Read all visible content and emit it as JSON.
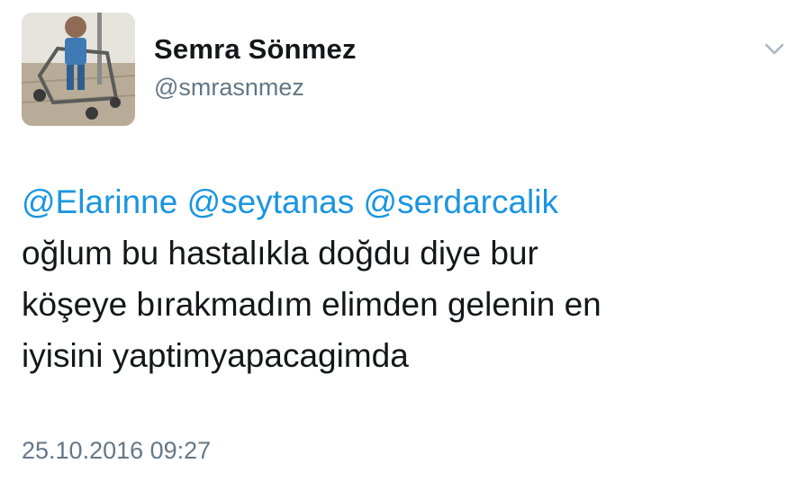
{
  "header": {
    "display_name": "Semra Sönmez",
    "handle": "@smrasnmez"
  },
  "tweet": {
    "mentions": [
      "@Elarinne",
      "@seytanas",
      "@serdarcalik"
    ],
    "lines": [
      "oğlum bu hastalıkla doğdu diye bur",
      "köşeye bırakmadım elimden gelenin en",
      "iyisini yaptimyapacagimda"
    ],
    "timestamp": "25.10.2016 09:27"
  },
  "icons": {
    "avatar": "avatar-photo",
    "menu": "chevron-down-icon"
  },
  "colors": {
    "mention": "#1b95e0",
    "text": "#14171a",
    "secondary": "#657786"
  }
}
